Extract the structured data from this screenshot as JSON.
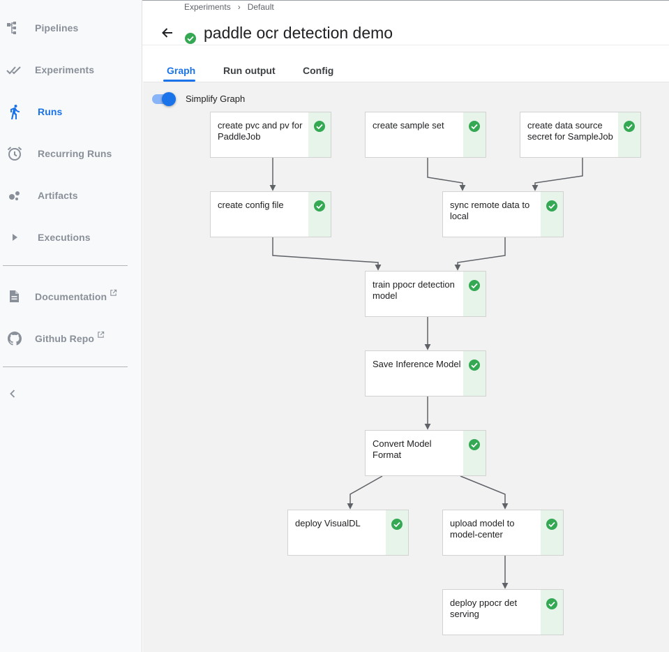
{
  "sidebar": {
    "items": [
      {
        "label": "Pipelines",
        "icon": "pipelines-icon"
      },
      {
        "label": "Experiments",
        "icon": "experiments-icon"
      },
      {
        "label": "Runs",
        "icon": "runs-icon"
      },
      {
        "label": "Recurring Runs",
        "icon": "alarm-clock-icon"
      },
      {
        "label": "Artifacts",
        "icon": "artifacts-icon"
      },
      {
        "label": "Executions",
        "icon": "play-icon"
      }
    ],
    "links": [
      {
        "label": "Documentation",
        "icon": "document-icon"
      },
      {
        "label": "Github Repo",
        "icon": "github-icon"
      }
    ],
    "active": "Runs",
    "collapse_icon": "chevron-left-icon"
  },
  "breadcrumb": {
    "items": [
      "Experiments",
      "Default"
    ],
    "separator": "›"
  },
  "header": {
    "title": "paddle ocr detection demo",
    "status": "succeeded"
  },
  "tabs": [
    {
      "label": "Graph",
      "active": true
    },
    {
      "label": "Run output",
      "active": false
    },
    {
      "label": "Config",
      "active": false
    }
  ],
  "graph": {
    "simplify_label": "Simplify Graph",
    "simplify_on": true,
    "nodes": [
      {
        "id": "n1",
        "label": "create pvc and pv for PaddleJob",
        "status": "succeeded"
      },
      {
        "id": "n2",
        "label": "create sample set",
        "status": "succeeded"
      },
      {
        "id": "n3",
        "label": "create data source secret for SampleJob",
        "status": "succeeded"
      },
      {
        "id": "n4",
        "label": "create config file",
        "status": "succeeded"
      },
      {
        "id": "n5",
        "label": "sync remote data to local",
        "status": "succeeded"
      },
      {
        "id": "n6",
        "label": "train ppocr detection model",
        "status": "succeeded"
      },
      {
        "id": "n7",
        "label": "Save Inference Model",
        "status": "succeeded"
      },
      {
        "id": "n8",
        "label": "Convert Model Format",
        "status": "succeeded"
      },
      {
        "id": "n9",
        "label": "deploy VisualDL",
        "status": "succeeded"
      },
      {
        "id": "n10",
        "label": "upload model to model-center",
        "status": "succeeded"
      },
      {
        "id": "n11",
        "label": "deploy ppocr det serving",
        "status": "succeeded"
      }
    ]
  },
  "colors": {
    "accent": "#1a73e8",
    "success": "#34a853",
    "status_bg": "#e6f4ea",
    "edge": "#5f6368"
  }
}
